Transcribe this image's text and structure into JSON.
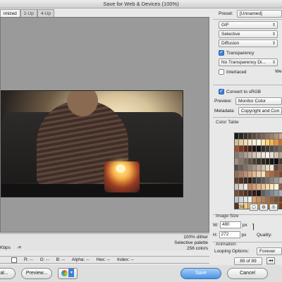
{
  "window": {
    "title": "Save for Web & Devices (100%)"
  },
  "tabs": [
    {
      "label": "imized"
    },
    {
      "label": "2-Up"
    },
    {
      "label": "4-Up"
    }
  ],
  "preview_info": {
    "left_text": "Kbps",
    "left_icon_text": "-≡",
    "right_lines": [
      "100% dither",
      "Selective palette",
      "256 colors"
    ]
  },
  "readout": {
    "r": "R: --",
    "g": "G: --",
    "b": "B: --",
    "alpha": "Alpha: --",
    "hex": "Hex: --",
    "index": "Index: --"
  },
  "bottom": {
    "cancel_label": "al...",
    "preview_label": "Preview...",
    "save_label": "Save",
    "cancel2_label": "Cancel"
  },
  "settings": {
    "preset_label": "Preset:",
    "preset_value": "[Unnamed]",
    "format_value": "GIF",
    "palette_value": "Selective",
    "dither_value": "Diffusion",
    "transparency_label": "Transparency",
    "transparency_checked": true,
    "matte_value": "No Transparency Di...",
    "interlaced_label": "Interlaced",
    "interlaced_checked": false,
    "web_label": "We",
    "convert_label": "Convert to sRGB",
    "convert_checked": true,
    "preview_label": "Preview:",
    "preview_value": "Monitor Color",
    "metadata_label": "Metadata:",
    "metadata_value": "Copyright and Con"
  },
  "color_table": {
    "title": "Color Table",
    "count": "256",
    "colors": [
      "#1c1b1c",
      "#2a2624",
      "#3b312c",
      "#4a3b33",
      "#5d4a3e",
      "#6f574a",
      "#7d6251",
      "#8d715e",
      "#9e8068",
      "#b19378",
      "#c6a98a",
      "#d6bb98",
      "#e4cca6",
      "#f0dcb4",
      "#f7e6c3",
      "#fbf0d6",
      "#fff7e0",
      "#ffe8a8",
      "#ffd66f",
      "#f7b64c",
      "#e79538",
      "#c9702a",
      "#a35024",
      "#7f391e",
      "#5c2818",
      "#3d1d14",
      "#271410",
      "#1a1311",
      "#2f2a27",
      "#3f3833",
      "#524740",
      "#63574e",
      "#74665c",
      "#86776b",
      "#98897c",
      "#ab9c8e",
      "#bfb09f",
      "#d2c4b2",
      "#e3d7c6",
      "#efe5d7",
      "#f8f1e6",
      "#e6ddd0",
      "#cfc3b3",
      "#b6a897",
      "#9f917f",
      "#887a69",
      "#726555",
      "#5d5144",
      "#4a4036",
      "#3a322a",
      "#2c2620",
      "#221d19",
      "#191512",
      "#100d0b",
      "#443c34",
      "#574c41",
      "#6b5d50",
      "#80705f",
      "#958470",
      "#aa9883",
      "#c0ad97",
      "#d5c3ac",
      "#e8d8c1",
      "#f3e7d3",
      "#6a4a3a",
      "#7e5a46",
      "#936b53",
      "#a87d61",
      "#bd9070",
      "#d2a480",
      "#e4b992",
      "#f2cda5",
      "#f9dfbb",
      "#b87a4a",
      "#a76a3e",
      "#925a34",
      "#7c4a2b",
      "#673d24",
      "#53311e",
      "#402618",
      "#301c13",
      "#3a3532",
      "#4d4743",
      "#615a55",
      "#756e68",
      "#8a837c",
      "#9f9891",
      "#b4ada6",
      "#c9c3bc",
      "#ded8d2",
      "#efeae5",
      "#c28a60",
      "#d49c6e",
      "#e5b07f",
      "#f2c492",
      "#f9d8a8",
      "#fde7bd",
      "#fff1d3",
      "#8f5c3c",
      "#7a4c31",
      "#653e28",
      "#503120",
      "#3e2619",
      "#2e1c13",
      "#231510",
      "#5a6068",
      "#6c737c",
      "#7f8790",
      "#939ba4",
      "#a8b0b8",
      "#bcc4cb",
      "#d0d7dd",
      "#e1e6ea",
      "#f0f3f5",
      "#d8a070",
      "#c88e60",
      "#b67d52",
      "#a36d46",
      "#8f5e3b",
      "#7b5031",
      "#684327",
      "#55371f",
      "#fbe0a0",
      "#f6cc80",
      "#efb665",
      "#e49f50",
      "#d68a41",
      "#c57636",
      "#b1642d",
      "#9c5426",
      "#874620",
      "#733a1b"
    ]
  },
  "image_size": {
    "title": "Image Size",
    "w_label": "W:",
    "w_value": "480",
    "h_label": "H:",
    "h_value": "272",
    "unit": "px",
    "quality_label": "Quality:"
  },
  "animation": {
    "title": "Animation",
    "looping_label": "Looping Options:",
    "looping_value": "Forever",
    "frame_counter": "89 of 89"
  }
}
